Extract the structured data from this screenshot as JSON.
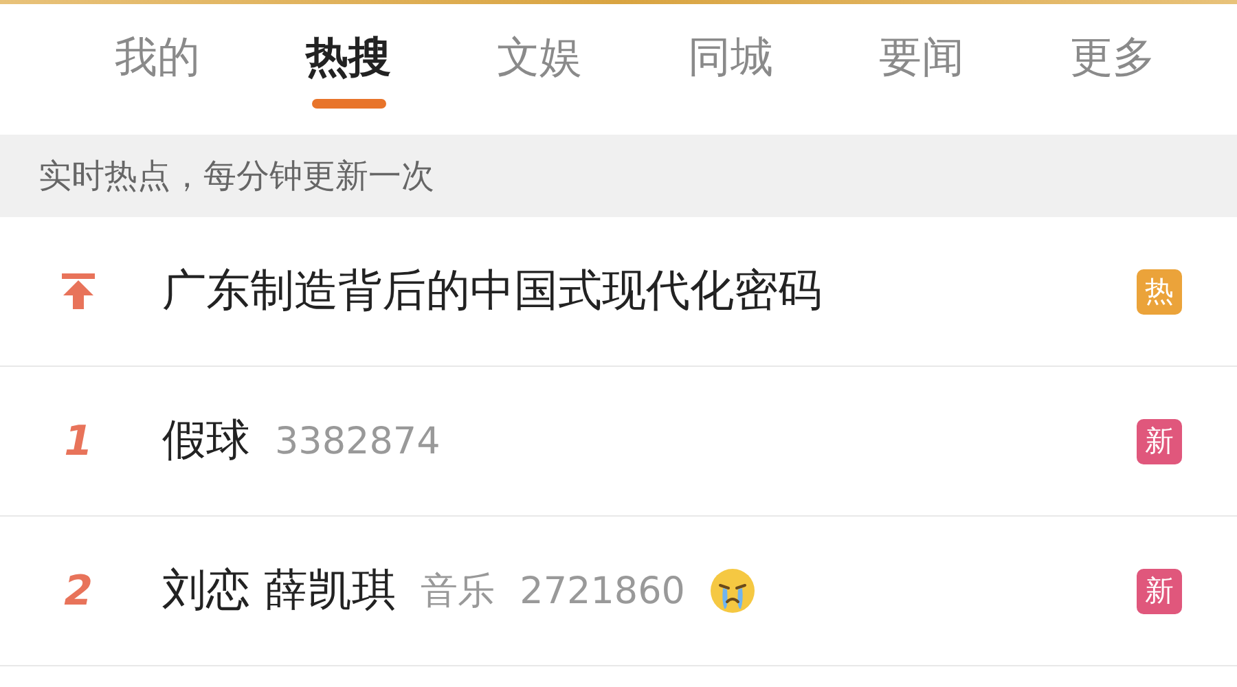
{
  "tabs": [
    {
      "label": "我的",
      "selected": false
    },
    {
      "label": "热搜",
      "selected": true
    },
    {
      "label": "文娱",
      "selected": false
    },
    {
      "label": "同城",
      "selected": false
    },
    {
      "label": "要闻",
      "selected": false
    },
    {
      "label": "更多",
      "selected": false
    }
  ],
  "notice": "实时热点，每分钟更新一次",
  "rows": [
    {
      "kind": "pinned",
      "title": "广东制造背后的中国式现代化密码",
      "badge": {
        "label": "热",
        "color": "#eba33a"
      }
    },
    {
      "kind": "ranked",
      "rank": "1",
      "title": "假球",
      "count": "3382874",
      "badge": {
        "label": "新",
        "color": "#e0577c"
      }
    },
    {
      "kind": "ranked",
      "rank": "2",
      "title": "刘恋 薛凯琪",
      "category": "音乐",
      "count": "2721860",
      "emoji": true,
      "badge": {
        "label": "新",
        "color": "#e0577c"
      }
    }
  ]
}
